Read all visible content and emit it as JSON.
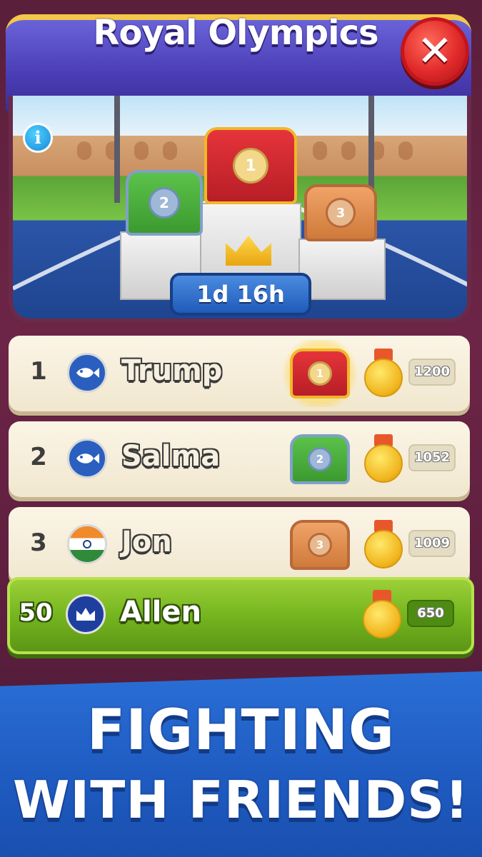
{
  "header": {
    "title": "Royal Olympics",
    "close_icon": "close-icon",
    "info_label": "i",
    "timer": "1d 16h"
  },
  "podium": [
    {
      "place": "1",
      "color": "#d6262e"
    },
    {
      "place": "2",
      "color": "#4aa83d"
    },
    {
      "place": "3",
      "color": "#e08a4a"
    }
  ],
  "leaderboard": [
    {
      "rank": "1",
      "name": "Trump",
      "avatar": "fish-icon",
      "chest": "1",
      "score": "1200"
    },
    {
      "rank": "2",
      "name": "Salma",
      "avatar": "fish-icon",
      "chest": "2",
      "score": "1052"
    },
    {
      "rank": "3",
      "name": "Jon",
      "avatar": "india-flag-icon",
      "chest": "3",
      "score": "1009"
    }
  ],
  "player": {
    "rank": "50",
    "name": "Allen",
    "avatar": "crown-icon",
    "score": "650"
  },
  "promo": {
    "line1": "FIGHTING",
    "line2": "WITH FRIENDS!"
  }
}
